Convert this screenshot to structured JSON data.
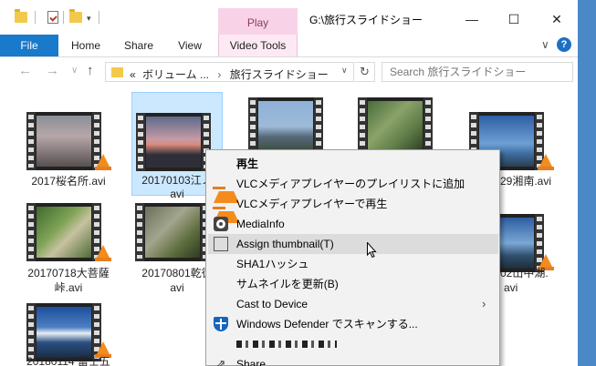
{
  "window": {
    "title": "G:\\旅行スライドショー",
    "context_tab_header": "Play",
    "controls": {
      "minimize": "—",
      "maximize": "☐",
      "close": "✕"
    }
  },
  "ribbon": {
    "tabs": [
      "File",
      "Home",
      "Share",
      "View",
      "Video Tools"
    ],
    "expand": "∨",
    "help": "?"
  },
  "address": {
    "back": "←",
    "forward": "→",
    "recent": "∨",
    "up": "↑",
    "path_prefix": "«",
    "crumb1": "ボリューム ...",
    "separator": "›",
    "crumb2": "旅行スライドショー",
    "dropdown": "∨",
    "refresh": "↻",
    "search_placeholder": "Search 旅行スライドショー"
  },
  "files": [
    {
      "name1": "2017桜名所.avi",
      "name2": ""
    },
    {
      "name1": "20170103江ノ",
      "name2": "avi"
    },
    {
      "name1": "",
      "name2": ""
    },
    {
      "name1": "",
      "name2": ""
    },
    {
      "name1": "29湘南.avi",
      "name2": ""
    },
    {
      "name1": "20170718大菩薩",
      "name2": "峠.avi"
    },
    {
      "name1": "20170801乾徳",
      "name2": "avi"
    },
    {
      "name1": "02山中湖.",
      "name2": "avi"
    },
    {
      "name1": "20180114 富士五",
      "name2": ""
    }
  ],
  "context_menu": {
    "items": [
      "再生",
      "VLCメディアプレイヤーのプレイリストに追加",
      "VLCメディアプレイヤーで再生",
      "MediaInfo",
      "Assign thumbnail(T)",
      "SHA1ハッシュ",
      "サムネイルを更新(B)",
      "Cast to Device",
      "Windows Defender でスキャンする...",
      "Share"
    ],
    "submenu_arrow": "›"
  },
  "colors": {
    "accent": "#1979ca",
    "video_tools": "#f8d3e7",
    "selection": "#cce8ff",
    "menu_bg": "#f2f2f2"
  }
}
